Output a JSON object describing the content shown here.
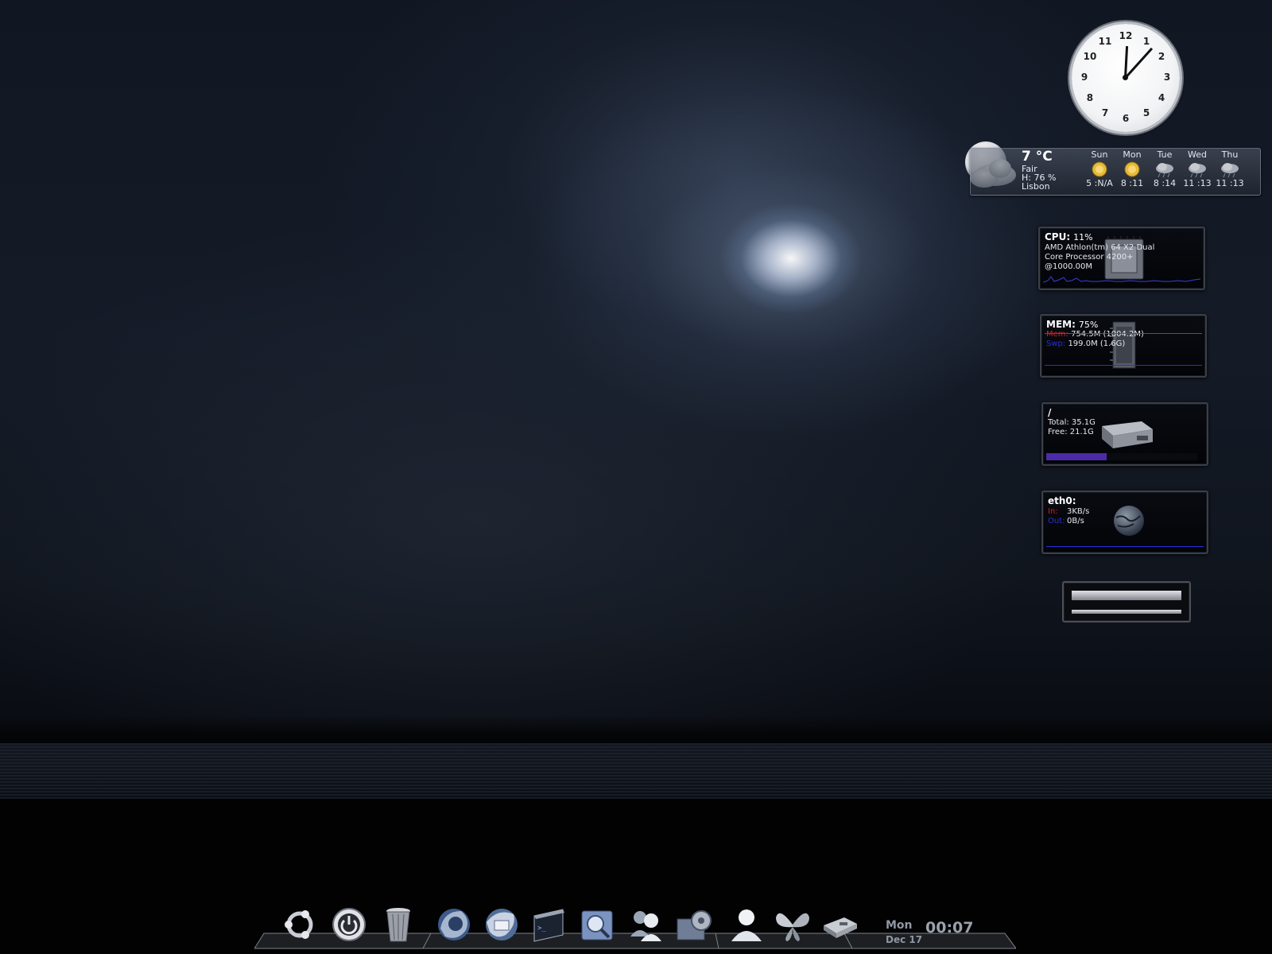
{
  "clock": {
    "numbers": [
      "12",
      "1",
      "2",
      "3",
      "4",
      "5",
      "6",
      "7",
      "8",
      "9",
      "10",
      "11"
    ],
    "time": "00:07"
  },
  "weather": {
    "temperature": "7 °C",
    "condition": "Fair",
    "humidity": "H: 76 %",
    "location": "Lisbon",
    "forecast": [
      {
        "day": "Sun",
        "temps": "5 :N/A",
        "icon": "sun-icon"
      },
      {
        "day": "Mon",
        "temps": "8 :11",
        "icon": "sun-icon"
      },
      {
        "day": "Tue",
        "temps": "8 :14",
        "icon": "rain-cloud-icon"
      },
      {
        "day": "Wed",
        "temps": "11 :13",
        "icon": "rain-cloud-icon"
      },
      {
        "day": "Thu",
        "temps": "11 :13",
        "icon": "rain-cloud-icon"
      }
    ]
  },
  "cpu": {
    "label": "CPU:",
    "value": "11%",
    "model_line1": "AMD Athlon(tm) 64 X2 Dual",
    "model_line2": "Core Processor 4200+",
    "freq": "@1000.00M",
    "graph_color": "#3b3fd9"
  },
  "mem": {
    "label": "MEM:",
    "value": "75%",
    "mem_label": "Mem:",
    "mem_value": "754.5M (1004.2M)",
    "swap_label": "Swp:",
    "swap_value": "199.0M (1.6G)",
    "mem_color": "#d91e1e",
    "swap_color": "#2b2fd9"
  },
  "disk": {
    "mount": "/",
    "total": "Total: 35.1G",
    "free": "Free: 21.1G",
    "used_fraction": 0.4,
    "bar_color": "#4b2ba8"
  },
  "net": {
    "iface": "eth0:",
    "in_label": "In:",
    "in_value": "3KB/s",
    "out_label": "Out:",
    "out_value": "0B/s",
    "in_color": "#d91e1e",
    "out_color": "#2b2fd9"
  },
  "dock": {
    "items": [
      {
        "icon": "ubuntu-logo-icon"
      },
      {
        "icon": "power-icon"
      },
      {
        "icon": "trash-icon"
      },
      {
        "icon": "firefox-icon"
      },
      {
        "icon": "thunderbird-icon"
      },
      {
        "icon": "terminal-icon"
      },
      {
        "icon": "disk-search-icon"
      },
      {
        "icon": "messenger-icon"
      },
      {
        "icon": "system-settings-icon"
      },
      {
        "icon": "user-icon"
      },
      {
        "icon": "butterfly-icon"
      },
      {
        "icon": "drive-icon"
      }
    ],
    "day": "Mon",
    "date": "Dec 17",
    "time": "00:07"
  }
}
